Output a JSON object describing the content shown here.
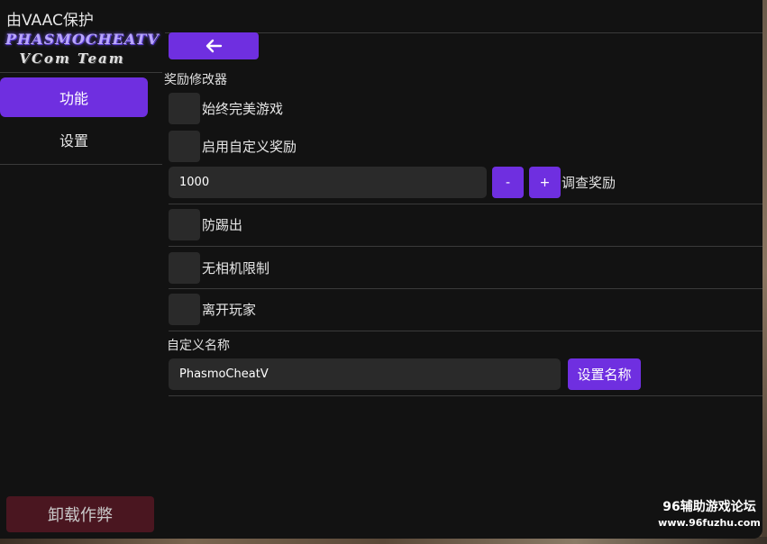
{
  "window": {
    "protection_text": "由VAAC保护"
  },
  "logo": {
    "line1": "PHASMOCHEATV",
    "line2": "VCom Team"
  },
  "sidebar": {
    "items": [
      {
        "label": "功能",
        "active": true
      },
      {
        "label": "设置",
        "active": false
      }
    ],
    "unload_label": "卸载作弊"
  },
  "toolbar": {
    "back_icon": "arrow-left-icon"
  },
  "rewards": {
    "section_label": "奖励修改器",
    "always_perfect_label": "始终完美游戏",
    "custom_reward_label": "启用自定义奖励",
    "reward_value": "1000",
    "minus_label": "-",
    "plus_label": "+",
    "adjust_label": "调查奖励"
  },
  "options": {
    "anti_kick_label": "防踢出",
    "no_camera_limit_label": "无相机限制",
    "leave_player_label": "离开玩家"
  },
  "custom_name": {
    "section_label": "自定义名称",
    "value": "PhasmoCheatV",
    "set_button_label": "设置名称"
  },
  "watermark": {
    "line1": "96辅助游戏论坛",
    "line2": "www.96fuzhu.com"
  },
  "colors": {
    "accent": "#6f2fe0",
    "window_bg": "#121212",
    "control_bg": "#2a2a2a",
    "unload_bg": "#4a1620"
  }
}
